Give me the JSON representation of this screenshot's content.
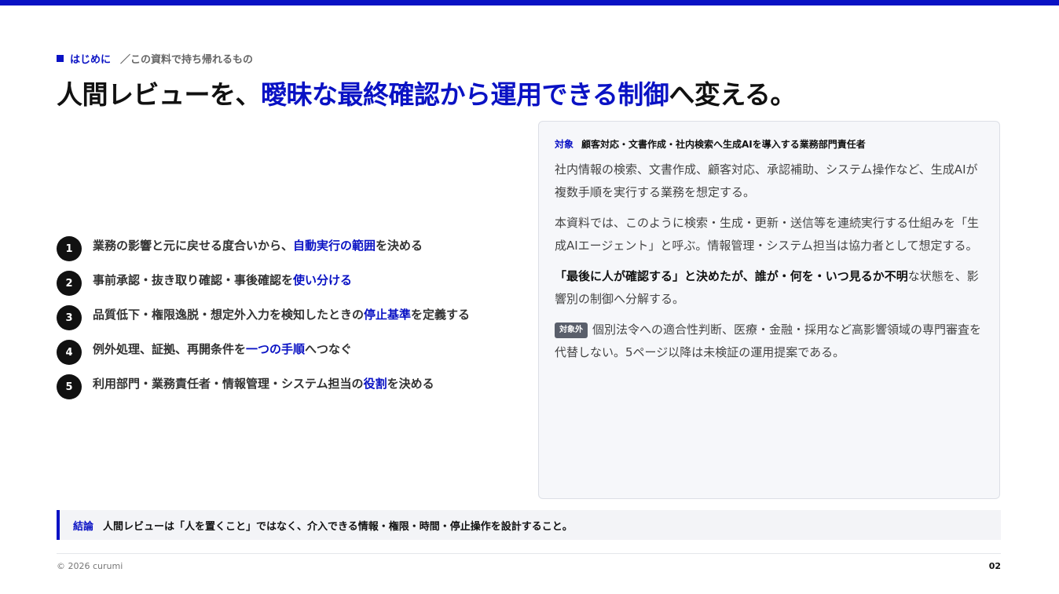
{
  "header": {
    "section": "はじめに",
    "subtitle": "／この資料で持ち帰れるもの",
    "title_pre": "人間レビューを、",
    "title_highlight": "曖昧な最終確認から運用できる制御",
    "title_post": "へ変える。"
  },
  "points": [
    {
      "num": "1",
      "pre": "業務の影響と元に戻せる度合いから、",
      "hl": "自動実行の範囲",
      "post": "を決める"
    },
    {
      "num": "2",
      "pre": "事前承認・抜き取り確認・事後確認を",
      "hl": "使い分ける",
      "post": ""
    },
    {
      "num": "3",
      "pre": "品質低下・権限逸脱・想定外入力を検知したときの",
      "hl": "停止基準",
      "post": "を定義する"
    },
    {
      "num": "4",
      "pre": "例外処理、証拠、再開条件を",
      "hl": "一つの手順",
      "post": "へつなぐ"
    },
    {
      "num": "5",
      "pre": "利用部門・業務責任者・情報管理・システム担当の",
      "hl": "役割",
      "post": "を決める"
    }
  ],
  "panel": {
    "target_label": "対象",
    "target_text": "顧客対応・文書作成・社内検索へ生成AIを導入する業務部門責任者",
    "p1": "社内情報の検索、文書作成、顧客対応、承認補助、システム操作など、生成AIが複数手順を実行する業務を想定する。",
    "p2": "本資料では、このように検索・生成・更新・送信等を連続実行する仕組みを「生成AIエージェント」と呼ぶ。情報管理・システム担当は協力者として想定する。",
    "p3_bold": "「最後に人が確認する」と決めたが、誰が・何を・いつ見るか不明",
    "p3_rest": "な状態を、影響別の制御へ分解する。",
    "out_badge": "対象外",
    "p4": "個別法令への適合性判断、医療・金融・採用など高影響領域の専門審査を代替しない。5ページ以降は未検証の運用提案である。"
  },
  "conclusion": {
    "label": "結論",
    "text": "人間レビューは「人を置くこと」ではなく、介入できる情報・権限・時間・停止操作を設計すること。"
  },
  "footer": {
    "copyright": "© 2026 curumi",
    "page": "02"
  }
}
